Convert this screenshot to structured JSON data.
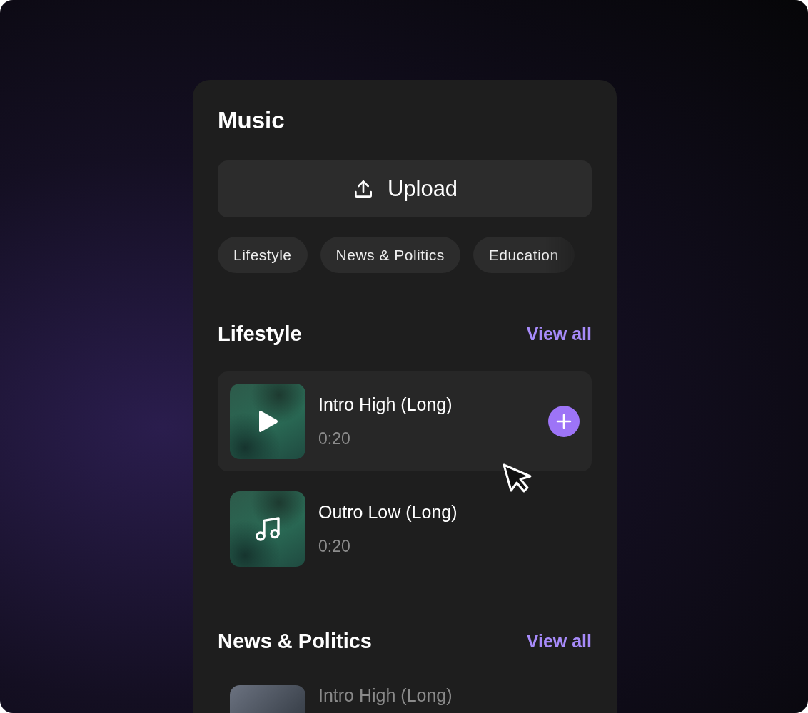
{
  "panel": {
    "title": "Music",
    "upload_button": "Upload"
  },
  "categories": [
    {
      "label": "Lifestyle"
    },
    {
      "label": "News & Politics"
    },
    {
      "label": "Education"
    }
  ],
  "sections": [
    {
      "title": "Lifestyle",
      "link": "View all",
      "tracks": [
        {
          "title": "Intro High (Long)",
          "duration": "0:20",
          "hovered": true,
          "faded": false
        },
        {
          "title": "Outro Low (Long)",
          "duration": "0:20",
          "hovered": false,
          "faded": false
        }
      ]
    },
    {
      "title": "News & Politics",
      "link": "View all",
      "tracks": [
        {
          "title": "Intro High (Long)",
          "hovered": false,
          "faded": true
        }
      ]
    }
  ]
}
